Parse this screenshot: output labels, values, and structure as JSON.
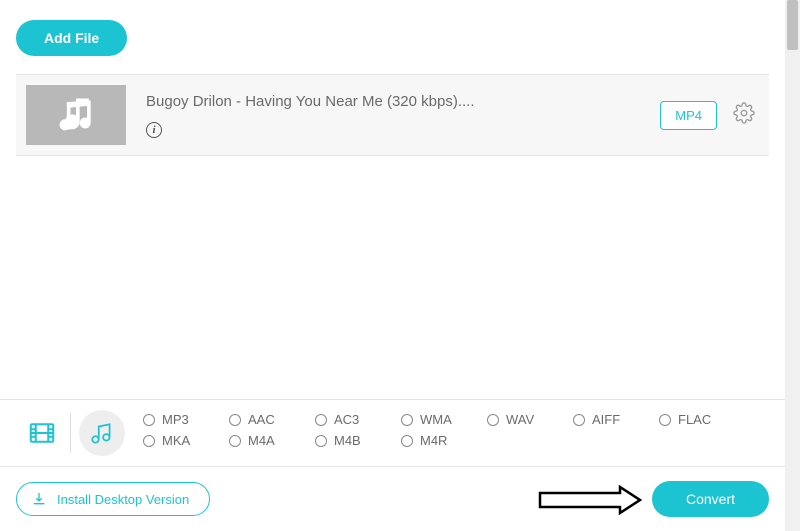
{
  "toolbar": {
    "add_file": "Add File"
  },
  "file": {
    "title": "Bugoy Drilon - Having You Near Me (320 kbps)....",
    "format_badge": "MP4"
  },
  "formats": {
    "row1": [
      "MP3",
      "AAC",
      "AC3",
      "WMA",
      "WAV",
      "AIFF",
      "FLAC"
    ],
    "row2": [
      "MKA",
      "M4A",
      "M4B",
      "M4R"
    ]
  },
  "actions": {
    "install": "Install Desktop Version",
    "convert": "Convert"
  }
}
